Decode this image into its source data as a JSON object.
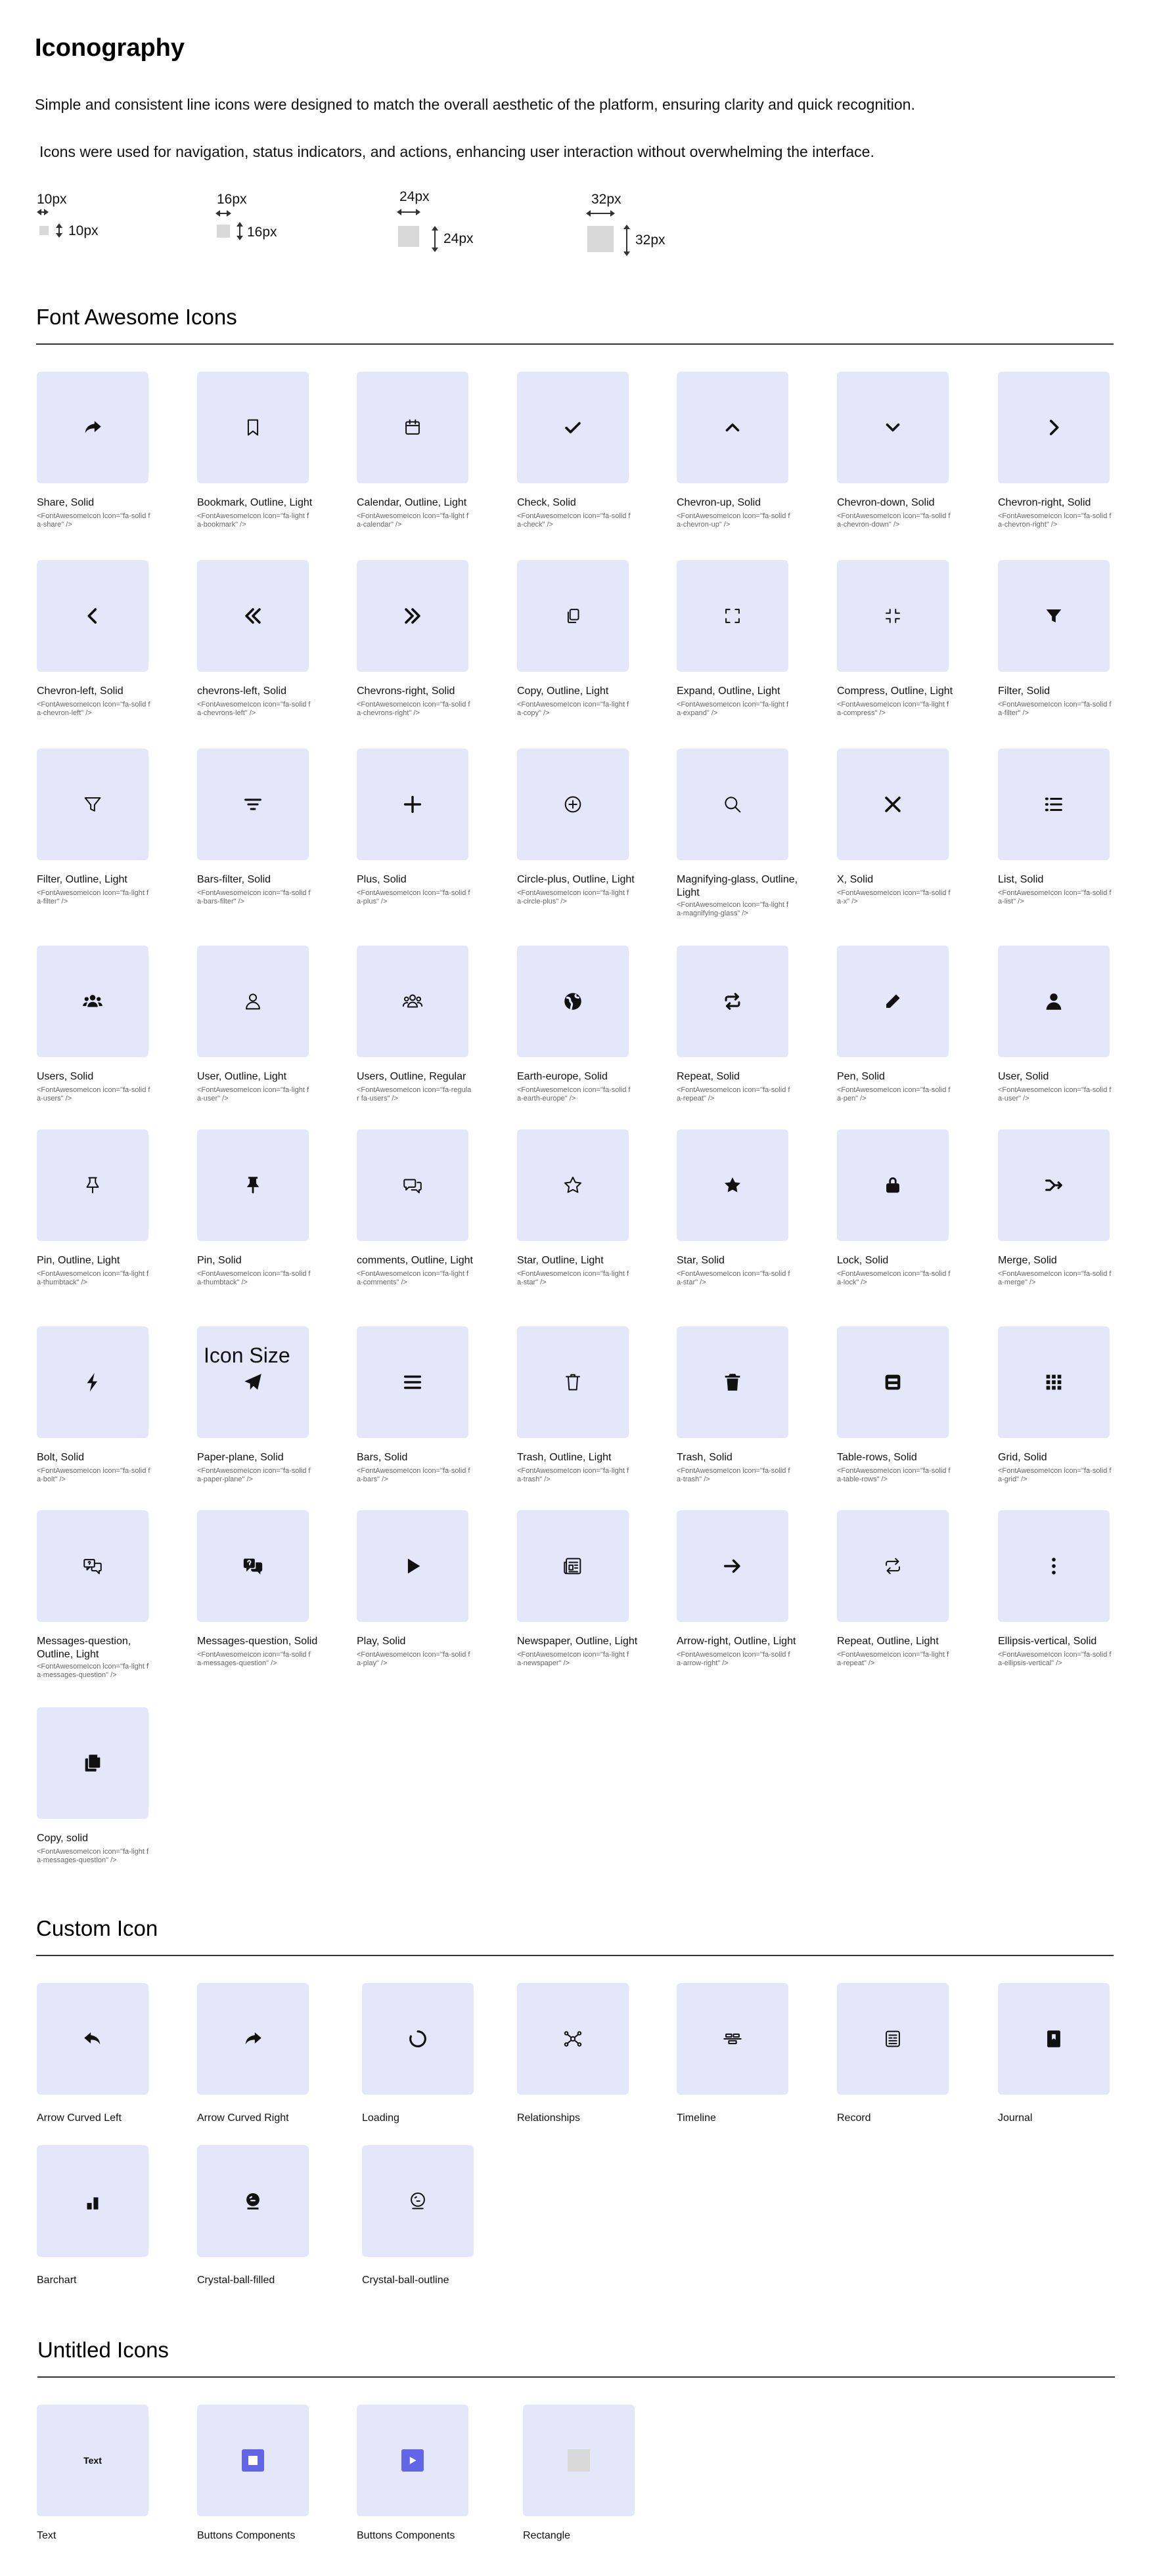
{
  "page": {
    "title": "Iconography",
    "intro_1": "Simple and consistent line icons were designed to match the overall aesthetic of the platform, ensuring clarity and quick recognition.",
    "intro_2": "Icons were used for navigation, status indicators, and actions, enhancing user interaction without overwhelming the interface."
  },
  "sizes": [
    {
      "label": "10px",
      "side_label": "10px"
    },
    {
      "label": "16px",
      "side_label": "16px"
    },
    {
      "label": "24px",
      "side_label": "24px"
    },
    {
      "label": "32px",
      "side_label": "32px"
    }
  ],
  "font_awesome": {
    "title": "Font Awesome Icons",
    "overlay_text": "Icon Size",
    "icons": [
      {
        "icon": "share-icon",
        "label": "Share, Solid",
        "code": "<FontAwesomeIcon icon=\"fa-solid fa-share\" />"
      },
      {
        "icon": "bookmark-icon",
        "label": "Bookmark, Outline, Light",
        "code": "<FontAwesomeIcon icon=\"fa-light fa-bookmark\" />"
      },
      {
        "icon": "calendar-icon",
        "label": "Calendar, Outline, Light",
        "code": "<FontAwesomeIcon icon=\"fa-light fa-calendar\" />"
      },
      {
        "icon": "check-icon",
        "label": "Check, Solid",
        "code": "<FontAwesomeIcon icon=\"fa-solid fa-check\" />"
      },
      {
        "icon": "chevron-up-icon",
        "label": "Chevron-up, Solid",
        "code": "<FontAwesomeIcon icon=\"fa-solid fa-chevron-up\" />"
      },
      {
        "icon": "chevron-down-icon",
        "label": "Chevron-down, Solid",
        "code": "<FontAwesomeIcon icon=\"fa-solid fa-chevron-down\" />"
      },
      {
        "icon": "chevron-right-icon",
        "label": "Chevron-right, Solid",
        "code": "<FontAwesomeIcon icon=\"fa-solid fa-chevron-right\" />"
      },
      {
        "icon": "chevron-left-icon",
        "label": "Chevron-left, Solid",
        "code": "<FontAwesomeIcon icon=\"fa-solid fa-chevron-left\" />"
      },
      {
        "icon": "chevrons-left-icon",
        "label": "chevrons-left, Solid",
        "code": "<FontAwesomeIcon icon=\"fa-solid fa-chevrons-left\" />"
      },
      {
        "icon": "chevrons-right-icon",
        "label": "Chevrons-right, Solid",
        "code": "<FontAwesomeIcon icon=\"fa-solid fa-chevrons-right\" />"
      },
      {
        "icon": "copy-icon",
        "label": "Copy, Outline, Light",
        "code": "<FontAwesomeIcon icon=\"fa-light fa-copy\" />"
      },
      {
        "icon": "expand-icon",
        "label": "Expand, Outline, Light",
        "code": "<FontAwesomeIcon icon=\"fa-light fa-expand\" />"
      },
      {
        "icon": "compress-icon",
        "label": "Compress, Outline, Light",
        "code": "<FontAwesomeIcon icon=\"fa-light fa-compress\" />"
      },
      {
        "icon": "filter-icon",
        "label": "Filter, Solid",
        "code": "<FontAwesomeIcon icon=\"fa-solid fa-filter\" />"
      },
      {
        "icon": "filter-outline-icon",
        "label": "Filter, Outline, Light",
        "code": "<FontAwesomeIcon icon=\"fa-light fa-filter\" />"
      },
      {
        "icon": "bars-filter-icon",
        "label": "Bars-filter, Solid",
        "code": "<FontAwesomeIcon icon=\"fa-solid fa-bars-filter\" />"
      },
      {
        "icon": "plus-icon",
        "label": "Plus, Solid",
        "code": "<FontAwesomeIcon icon=\"fa-solid fa-plus\" />"
      },
      {
        "icon": "circle-plus-icon",
        "label": "Circle-plus, Outline, Light",
        "code": "<FontAwesomeIcon icon=\"fa-light fa-circle-plus\" />"
      },
      {
        "icon": "magnifying-glass-icon",
        "label": "Magnifying-glass, Outline, Light",
        "code": "<FontAwesomeIcon icon=\"fa-light fa-magnifying-glass\" />"
      },
      {
        "icon": "x-icon",
        "label": "X, Solid",
        "code": "<FontAwesomeIcon icon=\"fa-solid fa-x\" />"
      },
      {
        "icon": "list-icon",
        "label": "List, Solid",
        "code": "<FontAwesomeIcon icon=\"fa-solid fa-list\" />"
      },
      {
        "icon": "users-icon",
        "label": "Users, Solid",
        "code": "<FontAwesomeIcon icon=\"fa-solid fa-users\" />"
      },
      {
        "icon": "user-outline-icon",
        "label": "User, Outline, Light",
        "code": "<FontAwesomeIcon icon=\"fa-light fa-user\" />"
      },
      {
        "icon": "users-outline-icon",
        "label": "Users, Outline, Regular",
        "code": "<FontAwesomeIcon icon=\"fa-regular fa-users\" />"
      },
      {
        "icon": "earth-europe-icon",
        "label": "Earth-europe, Solid",
        "code": "<FontAwesomeIcon icon=\"fa-solid fa-earth-europe\" />"
      },
      {
        "icon": "repeat-icon",
        "label": "Repeat, Solid",
        "code": "<FontAwesomeIcon icon=\"fa-solid fa-repeat\" />"
      },
      {
        "icon": "pen-icon",
        "label": "Pen, Solid",
        "code": "<FontAwesomeIcon icon=\"fa-solid fa-pen\" />"
      },
      {
        "icon": "user-icon",
        "label": "User, Solid",
        "code": "<FontAwesomeIcon icon=\"fa-solid fa-user\" />"
      },
      {
        "icon": "pin-outline-icon",
        "label": "Pin, Outline, Light",
        "code": "<FontAwesomeIcon icon=\"fa-light fa-thumbtack\" />"
      },
      {
        "icon": "pin-icon",
        "label": "Pin, Solid",
        "code": "<FontAwesomeIcon icon=\"fa-solid fa-thumbtack\" />"
      },
      {
        "icon": "comments-icon",
        "label": "comments, Outline, Light",
        "code": "<FontAwesomeIcon icon=\"fa-light fa-comments\" />"
      },
      {
        "icon": "star-outline-icon",
        "label": "Star, Outline, Light",
        "code": "<FontAwesomeIcon icon=\"fa-light fa-star\" />"
      },
      {
        "icon": "star-icon",
        "label": "Star, Solid",
        "code": "<FontAwesomeIcon icon=\"fa-solid fa-star\" />"
      },
      {
        "icon": "lock-icon",
        "label": "Lock, Solid",
        "code": "<FontAwesomeIcon icon=\"fa-solid fa-lock\" />"
      },
      {
        "icon": "merge-icon",
        "label": "Merge, Solid",
        "code": "<FontAwesomeIcon icon=\"fa-solid fa-merge\" />"
      },
      {
        "icon": "bolt-icon",
        "label": "Bolt, Solid",
        "code": "<FontAwesomeIcon icon=\"fa-solid fa-bolt\" />"
      },
      {
        "icon": "paper-plane-icon",
        "label": "Paper-plane, Solid",
        "code": "<FontAwesomeIcon icon=\"fa-solid fa-paper-plane\" />"
      },
      {
        "icon": "bars-icon",
        "label": "Bars, Solid",
        "code": "<FontAwesomeIcon icon=\"fa-solid fa-bars\" />"
      },
      {
        "icon": "trash-outline-icon",
        "label": "Trash, Outline, Light",
        "code": "<FontAwesomeIcon icon=\"fa-light fa-trash\" />"
      },
      {
        "icon": "trash-icon",
        "label": "Trash, Solid",
        "code": "<FontAwesomeIcon icon=\"fa-solid fa-trash\" />"
      },
      {
        "icon": "table-rows-icon",
        "label": "Table-rows, Solid",
        "code": "<FontAwesomeIcon icon=\"fa-solid fa-table-rows\" />"
      },
      {
        "icon": "grid-icon",
        "label": "Grid, Solid",
        "code": "<FontAwesomeIcon icon=\"fa-solid fa-grid\" />"
      },
      {
        "icon": "messages-question-outline-icon",
        "label": "Messages-question, Outline, Light",
        "code": "<FontAwesomeIcon icon=\"fa-light fa-messages-question\" />"
      },
      {
        "icon": "messages-question-icon",
        "label": "Messages-question, Solid",
        "code": "<FontAwesomeIcon icon=\"fa-solid fa-messages-question\" />"
      },
      {
        "icon": "play-icon",
        "label": "Play, Solid",
        "code": "<FontAwesomeIcon icon=\"fa-solid fa-play\" />"
      },
      {
        "icon": "newspaper-icon",
        "label": "Newspaper, Outline, Light",
        "code": "<FontAwesomeIcon icon=\"fa-light fa-newspaper\" />"
      },
      {
        "icon": "arrow-right-icon",
        "label": "Arrow-right, Outline, Light",
        "code": "<FontAwesomeIcon icon=\"fa-solid fa-arrow-right\" />"
      },
      {
        "icon": "repeat-outline-icon",
        "label": "Repeat, Outline, Light",
        "code": "<FontAwesomeIcon icon=\"fa-light fa-repeat\" />"
      },
      {
        "icon": "ellipsis-vertical-icon",
        "label": "Ellipsis-vertical, Solid",
        "code": "<FontAwesomeIcon icon=\"fa-solid fa-ellipsis-vertical\" />"
      },
      {
        "icon": "copy-solid-icon",
        "label": "Copy, solid",
        "code": "<FontAwesomeIcon icon=\"fa-light fa-messages-question\" />"
      }
    ]
  },
  "custom": {
    "title": "Custom Icon",
    "icons": [
      {
        "icon": "arrow-curved-left-icon",
        "label": "Arrow Curved Left"
      },
      {
        "icon": "arrow-curved-right-icon",
        "label": "Arrow Curved Right"
      },
      {
        "icon": "loading-icon",
        "label": "Loading"
      },
      {
        "icon": "relationships-icon",
        "label": "Relationships"
      },
      {
        "icon": "timeline-icon",
        "label": "Timeline"
      },
      {
        "icon": "record-icon",
        "label": "Record"
      },
      {
        "icon": "journal-icon",
        "label": "Journal"
      },
      {
        "icon": "barchart-icon",
        "label": "Barchart"
      },
      {
        "icon": "crystal-ball-filled-icon",
        "label": "Crystal-ball-filled"
      },
      {
        "icon": "crystal-ball-outline-icon",
        "label": "Crystal-ball-outline"
      }
    ]
  },
  "untitled": {
    "title": "Untitled Icons",
    "items": [
      {
        "kind": "text",
        "content": "Text",
        "label": "Text"
      },
      {
        "kind": "stop-button",
        "label": "Buttons Components"
      },
      {
        "kind": "play-button",
        "label": "Buttons Components"
      },
      {
        "kind": "rectangle",
        "label": "Rectangle"
      }
    ]
  },
  "colors": {
    "tile_bg": "#e4e7fa",
    "accent": "#6266e6",
    "icon": "#111111"
  }
}
